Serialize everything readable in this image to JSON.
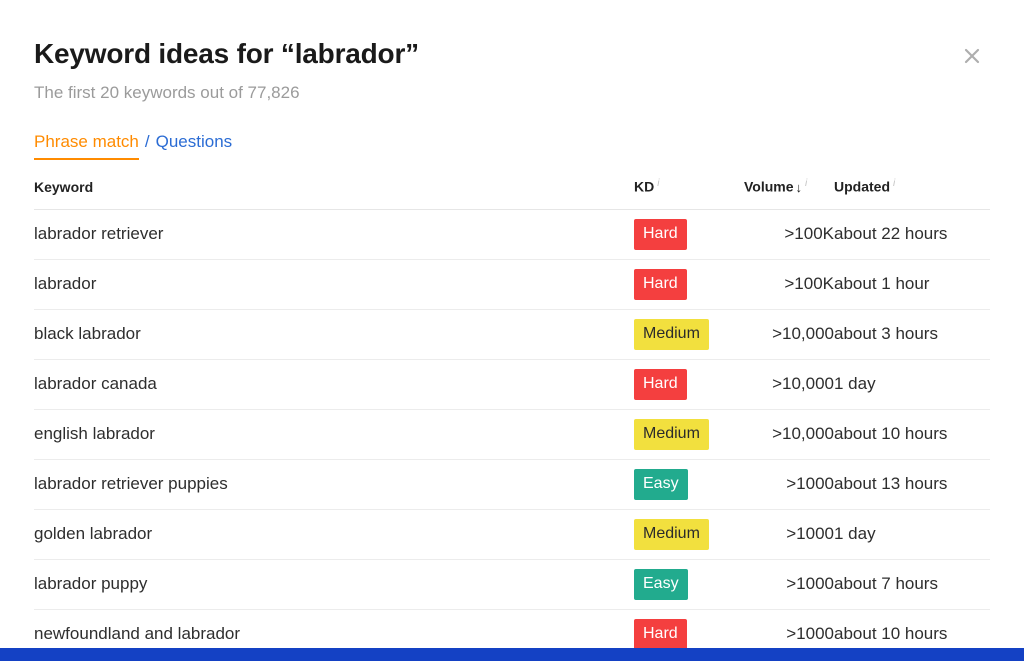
{
  "modal": {
    "title": "Keyword ideas for “labrador”",
    "subtitle": "The first 20 keywords out of 77,826",
    "close_label": "×"
  },
  "tabs": {
    "active_label": "Phrase match",
    "separator": "/",
    "link_label": "Questions"
  },
  "table": {
    "headers": {
      "keyword": "Keyword",
      "kd": "KD",
      "volume": "Volume",
      "volume_sort": "↓",
      "updated": "Updated",
      "info_glyph": "i"
    },
    "rows": [
      {
        "keyword": "labrador retriever",
        "kd": "Hard",
        "kd_level": "hard",
        "volume": ">100K",
        "updated": "about 22 hours"
      },
      {
        "keyword": "labrador",
        "kd": "Hard",
        "kd_level": "hard",
        "volume": ">100K",
        "updated": "about 1 hour"
      },
      {
        "keyword": "black labrador",
        "kd": "Medium",
        "kd_level": "medium",
        "volume": ">10,000",
        "updated": "about 3 hours"
      },
      {
        "keyword": "labrador canada",
        "kd": "Hard",
        "kd_level": "hard",
        "volume": ">10,000",
        "updated": "1 day"
      },
      {
        "keyword": "english labrador",
        "kd": "Medium",
        "kd_level": "medium",
        "volume": ">10,000",
        "updated": "about 10 hours"
      },
      {
        "keyword": "labrador retriever puppies",
        "kd": "Easy",
        "kd_level": "easy",
        "volume": ">1000",
        "updated": "about 13 hours"
      },
      {
        "keyword": "golden labrador",
        "kd": "Medium",
        "kd_level": "medium",
        "volume": ">1000",
        "updated": "1 day"
      },
      {
        "keyword": "labrador puppy",
        "kd": "Easy",
        "kd_level": "easy",
        "volume": ">1000",
        "updated": "about 7 hours"
      },
      {
        "keyword": "newfoundland and labrador",
        "kd": "Hard",
        "kd_level": "hard",
        "volume": ">1000",
        "updated": "about 10 hours"
      }
    ]
  },
  "colors": {
    "accent_orange": "#ff8b00",
    "link_blue": "#2b6cd4",
    "hard_red": "#f43f3f",
    "medium_yellow": "#f2e03e",
    "easy_green": "#22ab8e",
    "bottom_bar_blue": "#1441c4"
  }
}
